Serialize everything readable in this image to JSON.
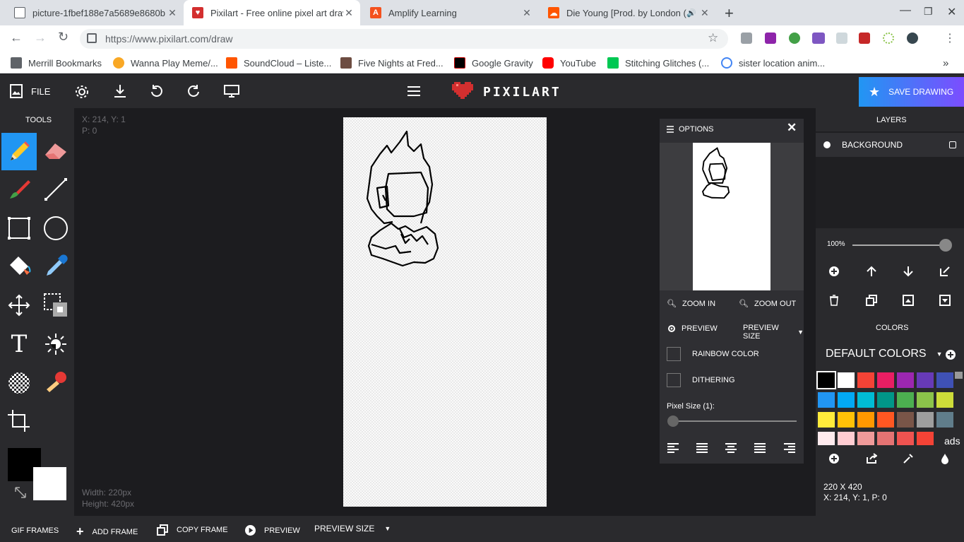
{
  "browser": {
    "tabs": [
      {
        "title": "picture-1fbef188e7a5689e8680b",
        "active": false
      },
      {
        "title": "Pixilart - Free online pixel art draw",
        "active": true
      },
      {
        "title": "Amplify Learning",
        "active": false
      },
      {
        "title": "Die Young [Prod. by London (",
        "active": false
      }
    ],
    "new_tab": "+",
    "url": "https://www.pixilart.com/draw",
    "bookmarks": [
      {
        "label": "Merrill Bookmarks"
      },
      {
        "label": "Wanna Play Meme/..."
      },
      {
        "label": "SoundCloud – Liste..."
      },
      {
        "label": "Five Nights at Fred..."
      },
      {
        "label": "Google Gravity"
      },
      {
        "label": "YouTube"
      },
      {
        "label": "Stitching Glitches (..."
      },
      {
        "label": "sister location anim..."
      }
    ],
    "more": "»"
  },
  "app": {
    "file_label": "FILE",
    "logo_text": "PIXILART",
    "save_label": "SAVE DRAWING",
    "tools_title": "TOOLS",
    "cursor_info": "X: 214, Y: 1",
    "pixel_info": "P: 0",
    "width_info": "Width: 220px",
    "height_info": "Height: 420px",
    "colors": {
      "accent": "#2196f3",
      "primary": "#000000",
      "secondary": "#ffffff"
    }
  },
  "options": {
    "title": "OPTIONS",
    "zoom_in": "ZOOM IN",
    "zoom_out": "ZOOM OUT",
    "preview": "PREVIEW",
    "preview_size": "PREVIEW SIZE",
    "rainbow": "RAINBOW COLOR",
    "dithering": "DITHERING",
    "pixel_size": "Pixel Size (1):"
  },
  "layers": {
    "title": "LAYERS",
    "items": [
      {
        "name": "BACKGROUND"
      }
    ],
    "opacity": "100%"
  },
  "colors_panel": {
    "title": "COLORS",
    "palette_name": "DEFAULT COLORS",
    "ads": "ads",
    "swatches": [
      "#000000",
      "#ffffff",
      "#f44336",
      "#e91e63",
      "#9c27b0",
      "#673ab7",
      "#3f51b5",
      "#2196f3",
      "#03a9f4",
      "#00bcd4",
      "#009688",
      "#4caf50",
      "#8bc34a",
      "#cddc39",
      "#ffeb3b",
      "#ffc107",
      "#ff9800",
      "#ff5722",
      "#795548",
      "#9e9e9e",
      "#607d8b",
      "#ffebee",
      "#ffcdd2",
      "#ef9a9a",
      "#e57373",
      "#ef5350",
      "#f44336"
    ],
    "size_text": "220 X 420",
    "pos_text": "X: 214, Y: 1, P: 0"
  },
  "bottom": {
    "gif_frames": "GIF FRAMES",
    "add_frame": "ADD FRAME",
    "copy_frame": "COPY FRAME",
    "preview": "PREVIEW",
    "preview_size": "PREVIEW SIZE"
  }
}
